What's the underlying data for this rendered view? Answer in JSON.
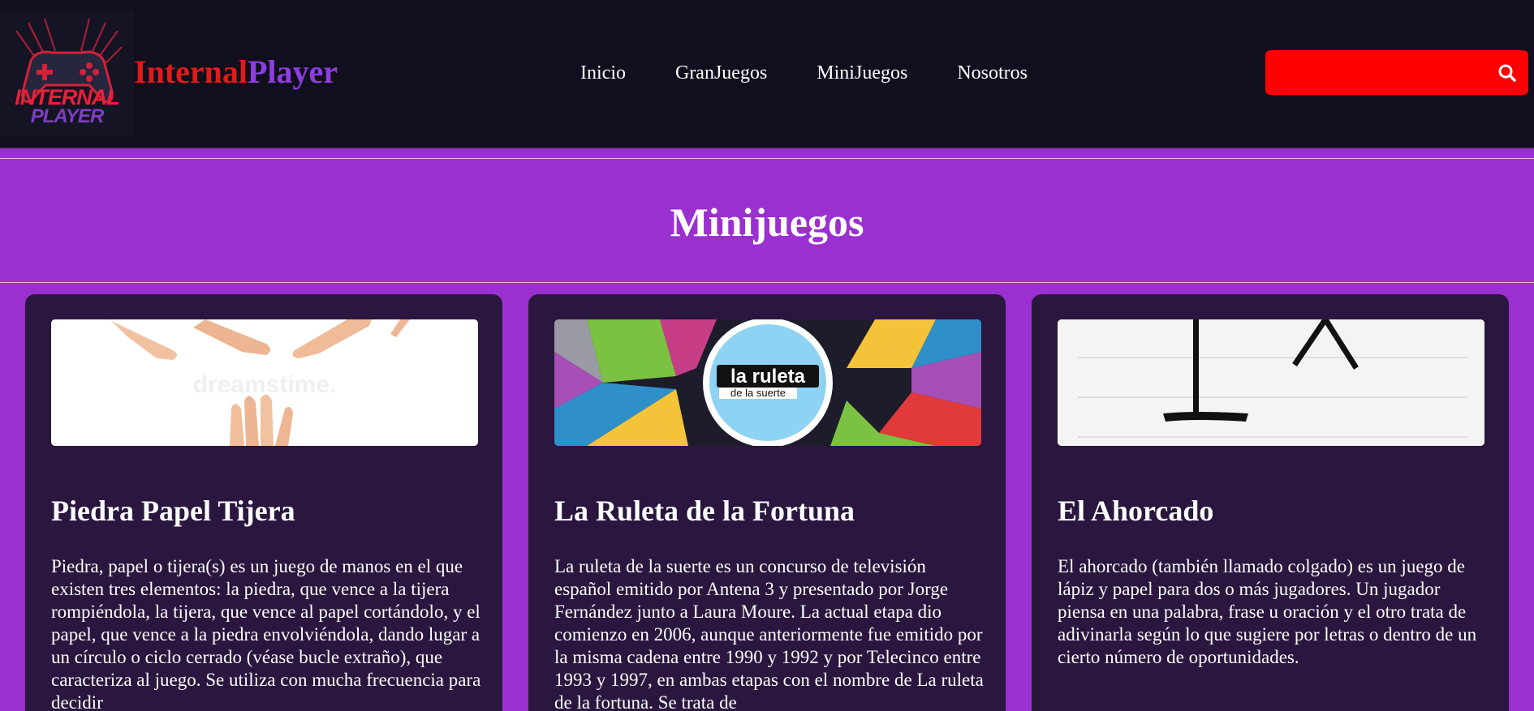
{
  "header": {
    "logo": {
      "line1": "INTERNAL",
      "line2": "PLAYER"
    },
    "brand": {
      "part1": "Internal",
      "part2": "Player"
    },
    "nav": [
      "Inicio",
      "GranJuegos",
      "MiniJuegos",
      "Nosotros"
    ],
    "search": {
      "placeholder": "",
      "icon": "search-icon"
    }
  },
  "hero": {
    "title": "Minijuegos"
  },
  "colors": {
    "header_bg": "#0f0f1d",
    "page_bg": "#9b30d0",
    "card_bg": "#2a163e",
    "search_bg": "#ff0000",
    "brand_red": "#e01b1b",
    "brand_purple": "#8d3ee0"
  },
  "cards": [
    {
      "title": "Piedra Papel Tijera",
      "image": "hands-rock-paper-scissors",
      "image_watermark": "dreamstime.",
      "description": "Piedra, papel o tijera(s) es un juego de manos en el que existen tres elementos: la piedra, que vence a la tijera rompiéndola, la tijera, que vence al papel cortándolo, y el papel, que vence a la piedra envolviéndola, dando lugar a un círculo o ciclo cerrado (véase bucle extraño), que caracteriza al juego. Se utiliza con mucha frecuencia para decidir"
    },
    {
      "title": "La Ruleta de la Fortuna",
      "image": "fortune-wheel",
      "image_logo": {
        "line1": "la ruleta",
        "line2": "de la suerte"
      },
      "description": "La ruleta de la suerte es un concurso de televisión español emitido por Antena 3 y presentado por Jorge Fernández junto a Laura Moure. La actual etapa dio comienzo en 2006, aunque anteriormente fue emitido por la misma cadena entre 1990 y 1992 y por Telecinco entre 1993 y 1997, en ambas etapas con el nombre de La ruleta de la fortuna. Se trata de"
    },
    {
      "title": "El Ahorcado",
      "image": "hangman-drawing",
      "description": "El ahorcado (también llamado colgado) es un juego de lápiz y papel para dos o más jugadores. Un jugador piensa en una palabra, frase u oración y el otro trata de adivinarla según lo que sugiere por letras o dentro de un cierto número de oportunidades."
    }
  ]
}
